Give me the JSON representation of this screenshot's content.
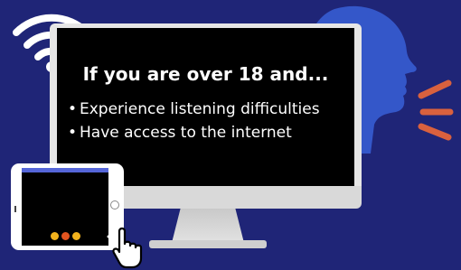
{
  "screen": {
    "headline": "If you are over  18 and...",
    "bullets": [
      "Experience listening difficulties",
      "Have access to the internet"
    ]
  },
  "icons": {
    "wifi": "wifi-icon",
    "head": "speaking-head-icon",
    "sound_waves": "sound-waves-icon",
    "hand": "pointing-hand-cursor-icon"
  },
  "colors": {
    "background": "#1f2577",
    "head": "#3457c9",
    "sound_waves": "#d9613e",
    "tablet_accent": "#5566d8"
  }
}
